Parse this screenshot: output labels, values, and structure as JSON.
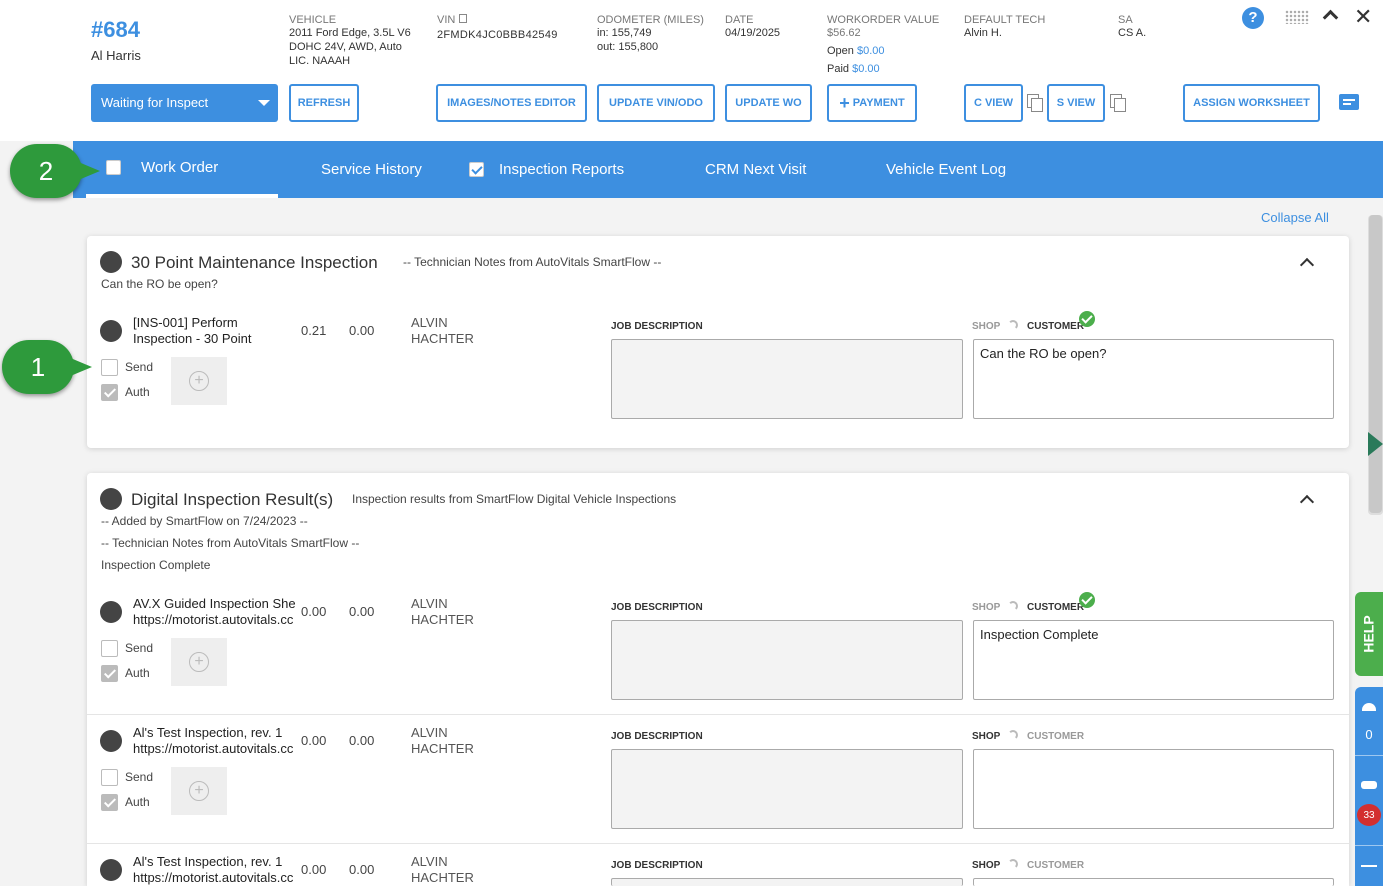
{
  "header": {
    "ro_number": "#684",
    "customer": "Al Harris",
    "vehicle_label": "VEHICLE",
    "vehicle_line1": "2011 Ford Edge, 3.5L V6",
    "vehicle_line2": "DOHC 24V, AWD, Auto",
    "vehicle_line3": "LIC. NAAAH",
    "vin_label": "VIN",
    "vin_value": "2FMDK4JC0BBB42549",
    "odometer_label": "ODOMETER (MILES)",
    "odometer_in": "in: 155,749",
    "odometer_out": "out: 155,800",
    "date_label": "DATE",
    "date_value": "04/19/2025",
    "wo_value_label": "WORKORDER VALUE",
    "wo_value": "$56.62",
    "open_label": "Open",
    "open_value": "$0.00",
    "paid_label": "Paid",
    "paid_value": "$0.00",
    "tech_label": "DEFAULT TECH",
    "tech_value": "Alvin H.",
    "sa_label": "SA",
    "sa_value": "CS A."
  },
  "toolbar": {
    "status": "Waiting for Inspect",
    "refresh": "REFRESH",
    "images_notes": "IMAGES/NOTES EDITOR",
    "update_vin": "UPDATE VIN/ODO",
    "update_wo": "UPDATE WO",
    "payment": "PAYMENT",
    "c_view": "C VIEW",
    "s_view": "S VIEW",
    "assign_worksheet": "ASSIGN WORKSHEET"
  },
  "tabs": [
    {
      "label": "Work Order"
    },
    {
      "label": "Service History"
    },
    {
      "label": "Inspection Reports"
    },
    {
      "label": "CRM Next Visit"
    },
    {
      "label": "Vehicle Event Log"
    }
  ],
  "callouts": {
    "one": "1",
    "two": "2"
  },
  "collapse_all": "Collapse All",
  "card1": {
    "title": "30 Point Maintenance Inspection",
    "subtitle": "-- Technician Notes from AutoVitals SmartFlow --",
    "note": "Can the RO be open?",
    "job": {
      "name1": "[INS-001] Perform",
      "name2": "Inspection - 30 Point",
      "hours": "0.21",
      "price": "0.00",
      "tech1": "ALVIN",
      "tech2": "HACHTER",
      "jd_label": "JOB DESCRIPTION",
      "shop": "SHOP",
      "customer": "CUSTOMER",
      "customer_note": "Can the RO be open?",
      "send": "Send",
      "auth": "Auth"
    }
  },
  "card2": {
    "title": "Digital Inspection Result(s)",
    "subtitle": "Inspection results from SmartFlow Digital Vehicle Inspections",
    "note1": "-- Added by SmartFlow on 7/24/2023 --",
    "note2": "-- Technician Notes from AutoVitals SmartFlow --",
    "note3": "Inspection Complete",
    "jobs": [
      {
        "name1": "AV.X Guided Inspection She",
        "name2": "https://motorist.autovitals.cc",
        "hours": "0.00",
        "price": "0.00",
        "tech1": "ALVIN",
        "tech2": "HACHTER",
        "jd_label": "JOB DESCRIPTION",
        "shop": "SHOP",
        "customer": "CUSTOMER",
        "customer_note": "Inspection Complete",
        "send": "Send",
        "auth": "Auth"
      },
      {
        "name1": "Al's Test Inspection, rev. 1",
        "name2": "https://motorist.autovitals.cc",
        "hours": "0.00",
        "price": "0.00",
        "tech1": "ALVIN",
        "tech2": "HACHTER",
        "jd_label": "JOB DESCRIPTION",
        "shop": "SHOP",
        "customer": "CUSTOMER",
        "customer_note": "",
        "send": "Send",
        "auth": "Auth"
      },
      {
        "name1": "Al's Test Inspection, rev. 1",
        "name2": "https://motorist.autovitals.cc",
        "hours": "0.00",
        "price": "0.00",
        "tech1": "ALVIN",
        "tech2": "HACHTER",
        "jd_label": "JOB DESCRIPTION",
        "shop": "SHOP",
        "customer": "CUSTOMER"
      }
    ]
  },
  "side": {
    "help": "HELP",
    "count0": "0",
    "count33": "33"
  },
  "colors": {
    "accent": "#3d8fe0",
    "callout": "#2e9a3c",
    "help": "#4cae4c"
  }
}
